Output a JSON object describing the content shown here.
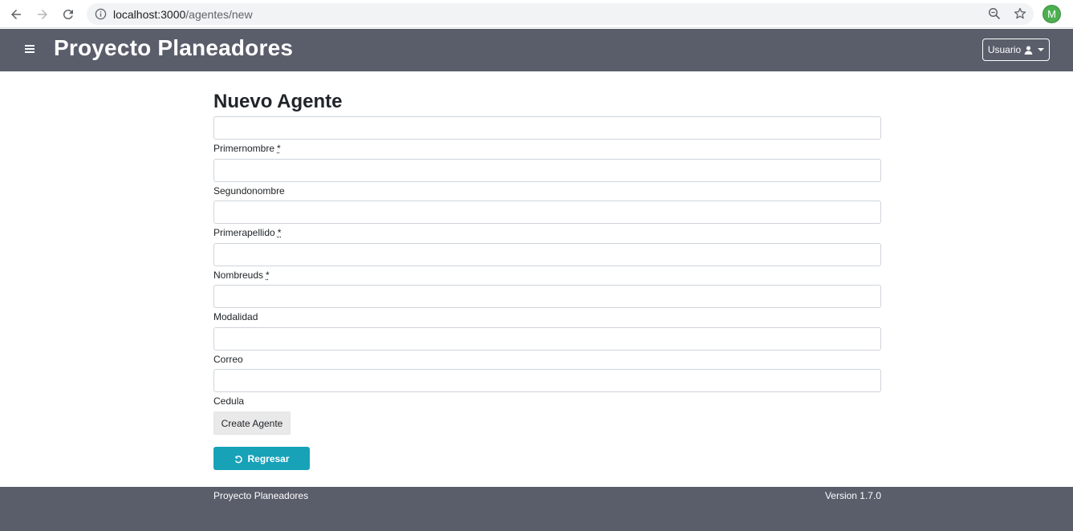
{
  "browser": {
    "url_host": "localhost:3000",
    "url_path": "/agentes/new",
    "profile_initial": "M"
  },
  "navbar": {
    "brand": "Proyecto Planeadores",
    "user_label": "Usuario"
  },
  "form": {
    "title": "Nuevo Agente",
    "fields": [
      {
        "label": "Primernombre",
        "required": true,
        "value": ""
      },
      {
        "label": "Segundonombre",
        "required": false,
        "value": ""
      },
      {
        "label": "Primerapellido",
        "required": true,
        "value": ""
      },
      {
        "label": "Nombreuds",
        "required": true,
        "value": ""
      },
      {
        "label": "Modalidad",
        "required": false,
        "value": ""
      },
      {
        "label": "Correo",
        "required": false,
        "value": ""
      },
      {
        "label": "Cedula",
        "required": false,
        "value": ""
      }
    ],
    "required_marker": "*",
    "submit_label": "Create Agente",
    "back_label": "Regresar"
  },
  "footer": {
    "left": "Proyecto Planeadores",
    "right": "Version 1.7.0"
  },
  "colors": {
    "navbar_bg": "#5a5e6b",
    "back_button": "#17a2b8",
    "avatar": "#4caf50"
  }
}
